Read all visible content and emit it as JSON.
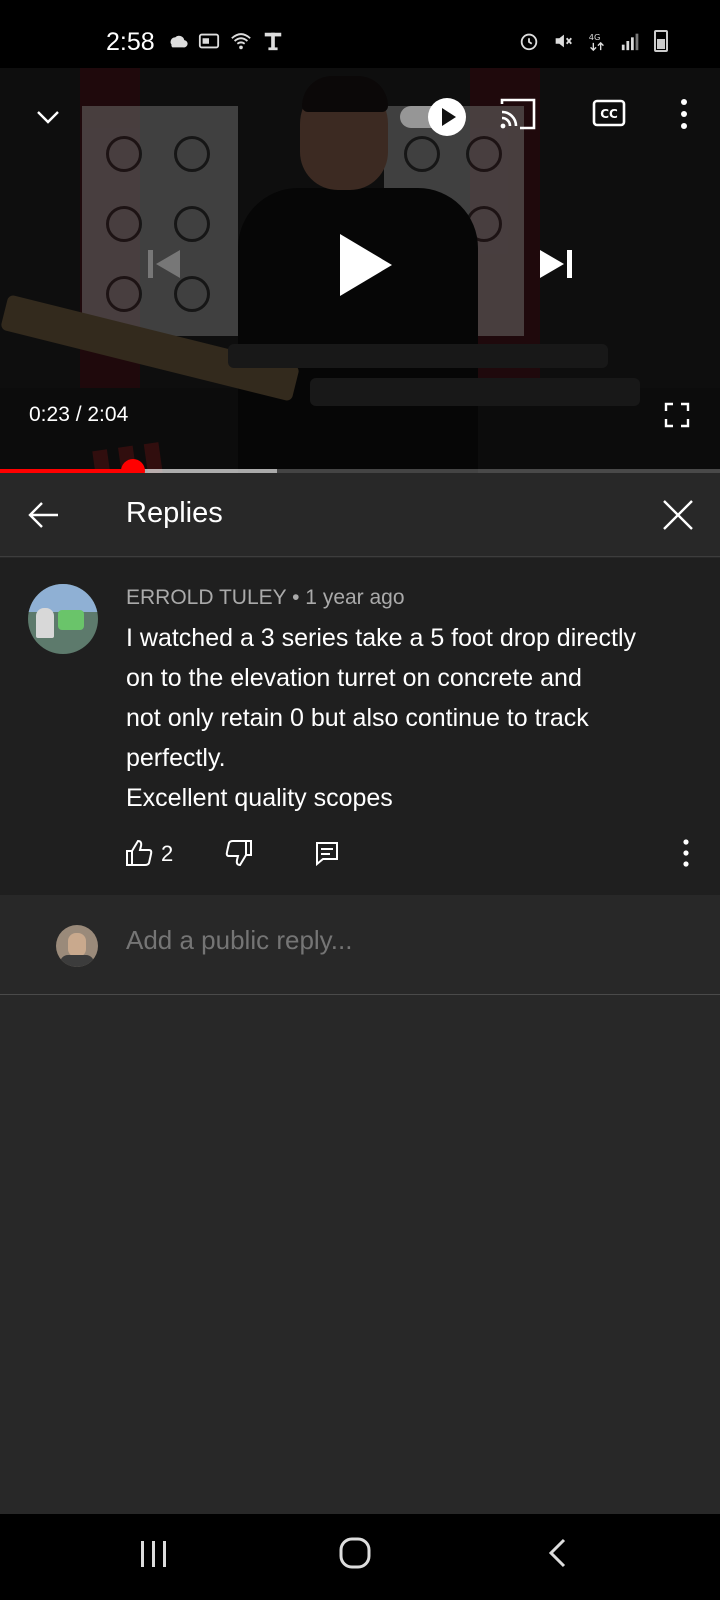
{
  "status_bar": {
    "time": "2:58",
    "left_icons": [
      "weather-icon",
      "mail-icon",
      "wifi-calling-icon",
      "tmobile-icon"
    ],
    "right_icons": [
      "alarm-icon",
      "mute-icon",
      "lte-icon",
      "signal-icon",
      "battery-icon"
    ]
  },
  "player": {
    "current_time": "0:23",
    "duration": "2:04",
    "time_display": "0:23 / 2:04",
    "progress_fraction": 0.185,
    "buffered_fraction": 0.385,
    "autoplay": true,
    "controls": [
      "minimize-icon",
      "autoplay-toggle",
      "cast-icon",
      "captions-icon",
      "more-icon",
      "previous-icon",
      "play-icon",
      "next-icon",
      "fullscreen-icon"
    ],
    "accent_color": "#ff0000"
  },
  "replies_panel": {
    "title": "Replies"
  },
  "comment": {
    "author": "ERROLD TULEY",
    "age": "1 year ago",
    "meta": "ERROLD TULEY • 1 year ago",
    "text_lines": [
      "I watched a 3 series take a 5 foot drop directly",
      "on to the elevation turret on concrete and",
      "not only retain 0 but also continue to track",
      "perfectly.",
      "Excellent quality scopes"
    ],
    "like_count": "2"
  },
  "reply_box": {
    "placeholder": "Add a public reply..."
  },
  "nav_bar": {
    "buttons": [
      "recent-apps-icon",
      "home-icon",
      "back-icon"
    ]
  }
}
